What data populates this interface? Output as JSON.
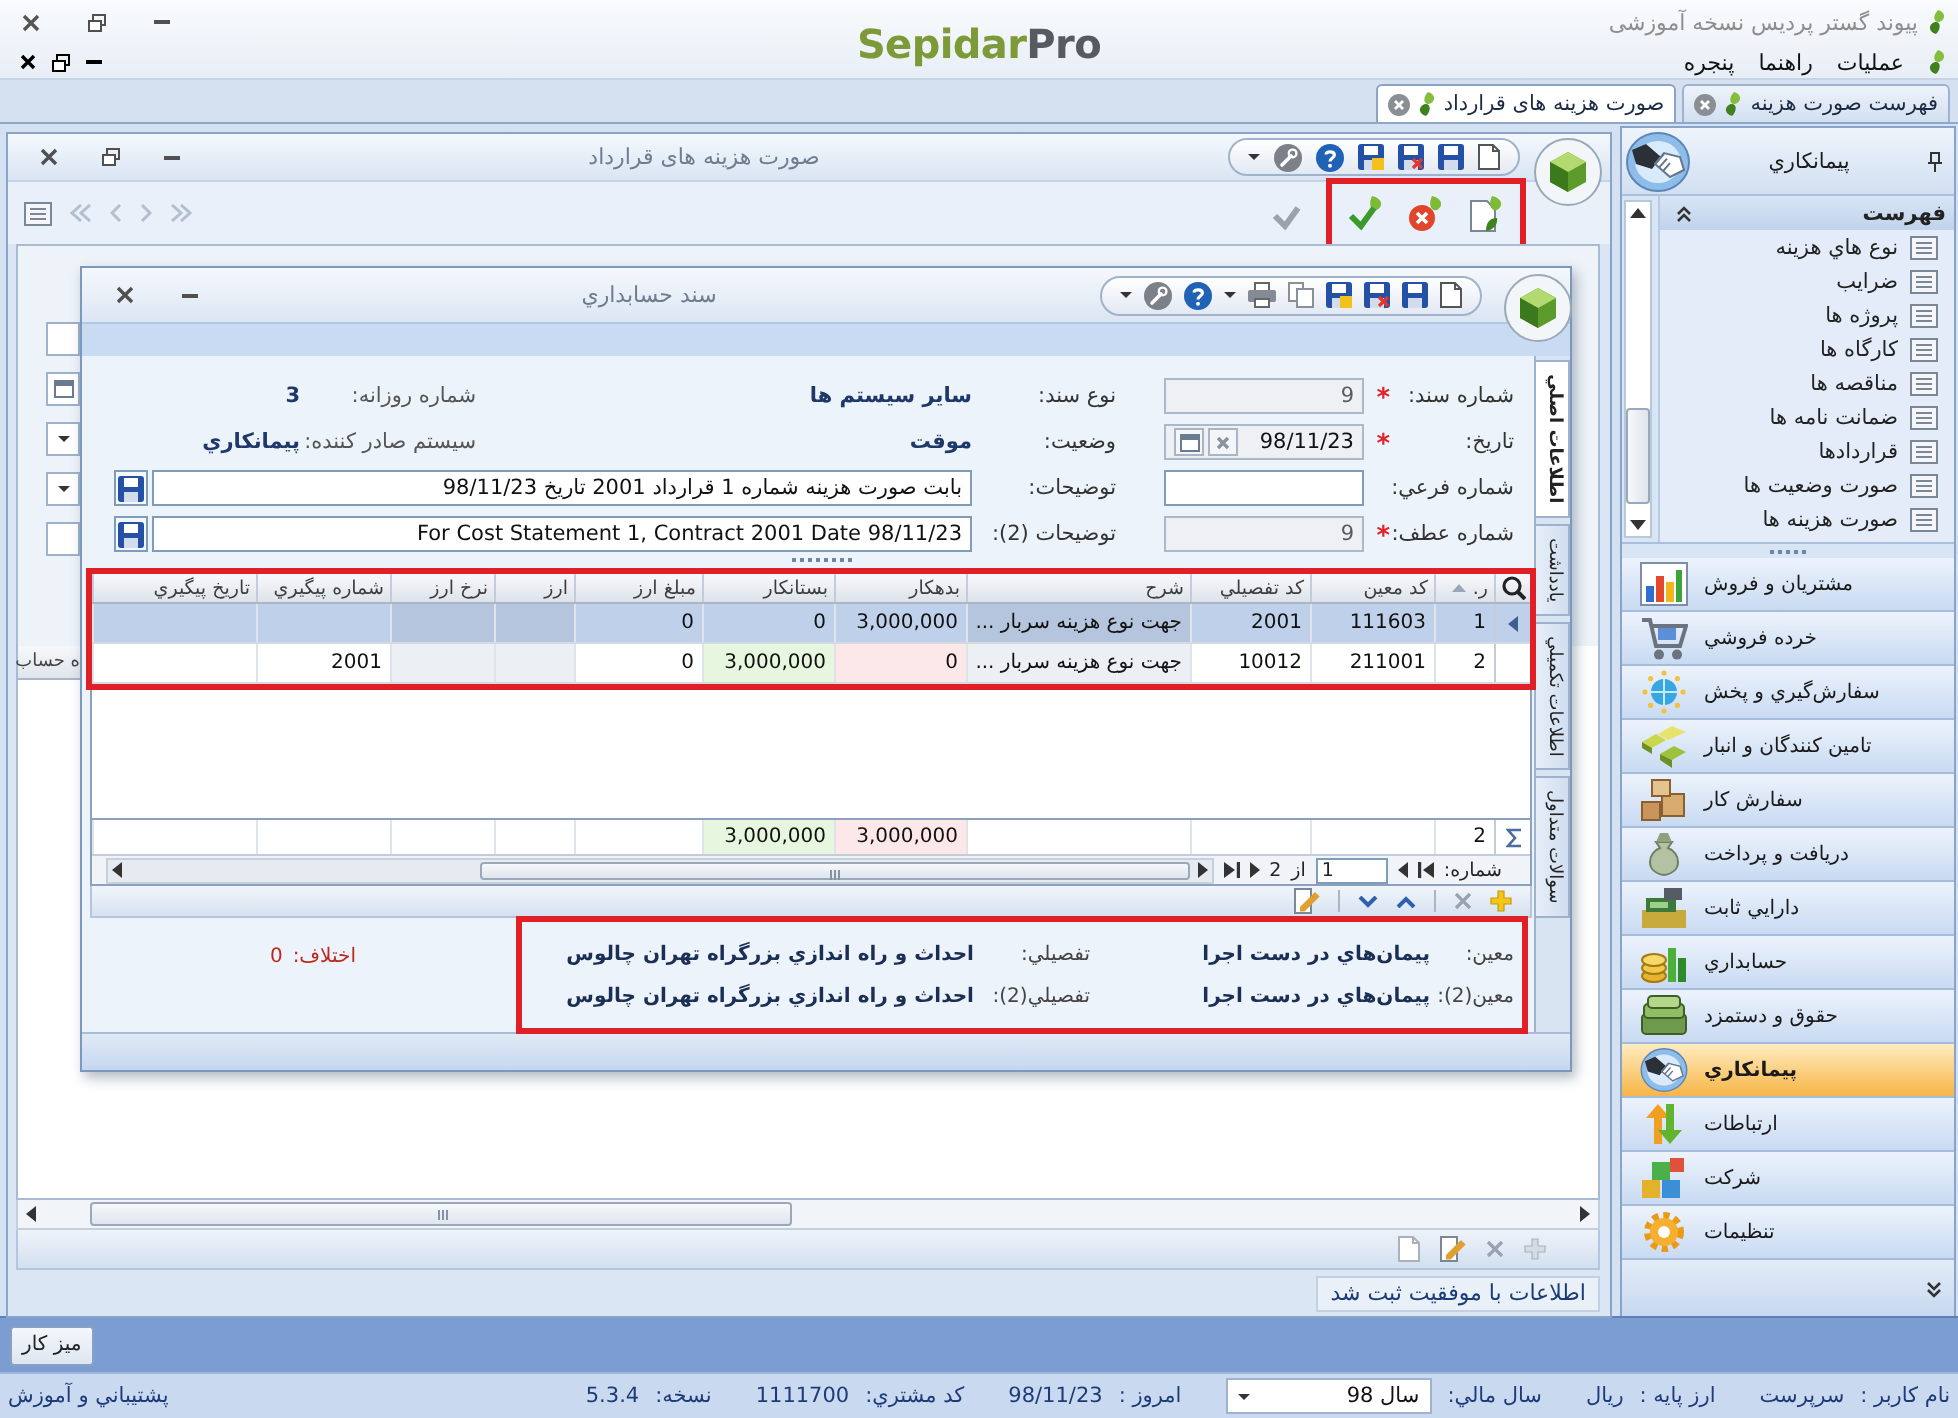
{
  "app": {
    "title": "پیوند گستر پردیس نسخه آموزشی",
    "logo": {
      "brand": "Sepidar",
      "suffix": "Pro"
    },
    "menu": [
      {
        "label": "عملیات"
      },
      {
        "label": "راهنما"
      },
      {
        "label": "پنجره"
      }
    ]
  },
  "doc_tabs": [
    {
      "label": "فهرست صورت هزینه",
      "selected": false
    },
    {
      "label": "صورت هزینه های قرارداد",
      "selected": true
    }
  ],
  "window": {
    "title": "صورت هزینه های قرارداد",
    "actions_highlighted": true,
    "grid_columns": [
      "ه حساب"
    ],
    "status_message": "اطلاعات با موفقیت ثبت شد"
  },
  "dialog": {
    "title": "سند حسابداري",
    "form": {
      "main": [
        {
          "label": "شماره سند:",
          "required": "*",
          "value": "9",
          "kind": "readonly"
        },
        {
          "label": "تاریخ:",
          "required": "*",
          "value": "98/11/23",
          "kind": "date"
        },
        {
          "label": "شماره فرعي:",
          "kind": "text"
        },
        {
          "label": "شماره عطف:",
          "required": "*",
          "value": "9",
          "kind": "readonly"
        }
      ],
      "details": [
        {
          "label": "نوع سند:",
          "value": "سایر سیستم ها",
          "kind": "readout"
        },
        {
          "label": "وضعیت:",
          "value": "موقت",
          "kind": "readout"
        },
        {
          "label": "توضیحات:",
          "value": "بابت صورت هزینه شماره 1 قرارداد 2001 تاریخ 98/11/23",
          "kind": "memo"
        },
        {
          "label": "توضیحات (2):",
          "value": "For Cost Statement 1, Contract 2001 Date 98/11/23",
          "kind": "memo"
        }
      ],
      "info": [
        {
          "label": "شماره روزانه:",
          "value": "3"
        },
        {
          "label": "سیستم صادر کننده:",
          "value": "پیمانکاري"
        }
      ]
    },
    "side_tabs": [
      {
        "label": "اطلاعات اصلي",
        "selected": true
      },
      {
        "label": "یادداشت",
        "selected": false
      },
      {
        "label": "اطلاعات تکمیلي",
        "selected": false
      },
      {
        "label": "سوالات متداول",
        "selected": false
      }
    ],
    "table": {
      "highlighted": true,
      "columns": [
        {
          "label": "ر.",
          "kind": "index",
          "sorted": true
        },
        {
          "label": "کد معین",
          "kind": "code",
          "sorted": false
        },
        {
          "label": "کد تفصیلي",
          "kind": "code",
          "sorted": false
        },
        {
          "label": "شرح",
          "kind": "readonly",
          "sorted": false
        },
        {
          "label": "بدهکار",
          "kind": "debit",
          "sorted": false
        },
        {
          "label": "بستانکار",
          "kind": "credit",
          "sorted": false
        },
        {
          "label": "مبلغ ارز",
          "kind": "amount",
          "sorted": false
        },
        {
          "label": "ارز",
          "kind": "readonly",
          "sorted": false
        },
        {
          "label": "نرخ ارز",
          "kind": "readonly",
          "sorted": false
        },
        {
          "label": "شماره پیگیري",
          "kind": "code",
          "sorted": false
        },
        {
          "label": "تاریخ پیگیري",
          "kind": "date",
          "sorted": false
        }
      ],
      "rows": [
        {
          "selected": true,
          "cells": [
            "1",
            "111603",
            "2001",
            "جهت نوع هزینه سربار ...",
            "3,000,000",
            "0",
            "0",
            null,
            null,
            null,
            null
          ]
        },
        {
          "selected": false,
          "cells": [
            "2",
            "211001",
            "10012",
            "جهت نوع هزینه سربار ...",
            "0",
            "3,000,000",
            "0",
            null,
            null,
            "2001",
            null
          ]
        }
      ],
      "totals": {
        "count": "2",
        "debit": "3,000,000",
        "credit": "3,000,000"
      }
    },
    "pager": {
      "label": "شماره:",
      "page": "1",
      "of": "از",
      "total": "2"
    },
    "accounts": {
      "highlighted": true,
      "items": [
        {
          "label": "معین:",
          "value": "پیمان‌هاي در دست اجرا"
        },
        {
          "label": "تفصیلي:",
          "value": "احداث و راه اندازي بزرگراه تهران چالوس"
        },
        {
          "label": "معین(2):",
          "value": "پیمان‌هاي در دست اجرا"
        },
        {
          "label": "تفصیلي(2):",
          "value": "احداث و راه اندازي بزرگراه تهران چالوس"
        }
      ]
    },
    "difference": {
      "label": "اختلاف:",
      "value": "0"
    }
  },
  "sidebar": {
    "title": "پیمانکاري",
    "list": {
      "title": "فهرست",
      "items": [
        "نوع هاي هزینه",
        "ضرایب",
        "پروژه ها",
        "کارگاه ها",
        "مناقصه ها",
        "ضمانت نامه ها",
        "قراردادها",
        "صورت وضعیت ها",
        "صورت هزینه ها"
      ]
    },
    "modules": [
      {
        "label": "مشتریان و فروش",
        "selected": false
      },
      {
        "label": "خرده فروشي",
        "selected": false
      },
      {
        "label": "سفارش‌گیري و پخش",
        "selected": false
      },
      {
        "label": "تامین کنندگان و انبار",
        "selected": false
      },
      {
        "label": "سفارش کار",
        "selected": false
      },
      {
        "label": "دریافت و پرداخت",
        "selected": false
      },
      {
        "label": "دارایي ثابت",
        "selected": false
      },
      {
        "label": "حسابداري",
        "selected": false
      },
      {
        "label": "حقوق و دستمزد",
        "selected": false
      },
      {
        "label": "پیمانکاري",
        "selected": true
      },
      {
        "label": "ارتباطات",
        "selected": false
      },
      {
        "label": "شرکت",
        "selected": false
      },
      {
        "label": "تنظیمات",
        "selected": false
      }
    ]
  },
  "taskbar": {
    "button": "میز کار"
  },
  "status_bar": {
    "items": [
      {
        "label": "نام کاربر :",
        "value": "سرپرست",
        "kind": "text"
      },
      {
        "label": "ارز پایه :",
        "value": "ریال",
        "kind": "text"
      },
      {
        "label": "سال مالي:",
        "value": "سال 98",
        "kind": "select"
      },
      {
        "label": "امروز :",
        "value": "98/11/23",
        "kind": "text"
      },
      {
        "label": "کد مشتري:",
        "value": "1111700",
        "kind": "text"
      },
      {
        "label": "نسخه:",
        "value": "5.3.4",
        "kind": "text"
      }
    ],
    "support": "پشتیباني و آموزش"
  }
}
